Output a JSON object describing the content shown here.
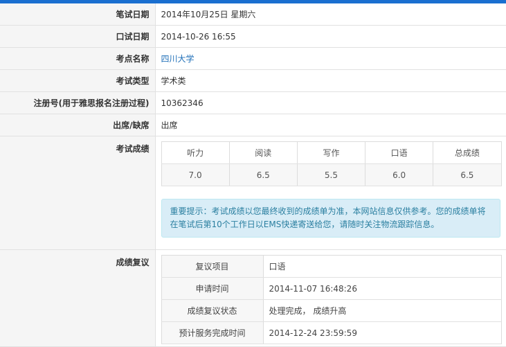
{
  "info": {
    "written_date_label": "笔试日期",
    "written_date": "2014年10月25日 星期六",
    "oral_date_label": "口试日期",
    "oral_date": "2014-10-26 16:55",
    "venue_label": "考点名称",
    "venue": "四川大学",
    "type_label": "考试类型",
    "type": "学术类",
    "reg_label": "注册号(用于雅思报名注册过程)",
    "reg": "10362346",
    "attend_label": "出席/缺席",
    "attend": "出席"
  },
  "scores": {
    "label": "考试成绩",
    "headers": [
      "听力",
      "阅读",
      "写作",
      "口语",
      "总成绩"
    ],
    "values": [
      "7.0",
      "6.5",
      "5.5",
      "6.0",
      "6.5"
    ],
    "notice": "重要提示：考试成绩以您最终收到的成绩单为准，本网站信息仅供参考。您的成绩单将在笔试后第10个工作日以EMS快递寄送给您，请随时关注物流跟踪信息。"
  },
  "recheck": {
    "label": "成绩复议",
    "rows": [
      {
        "k": "复议项目",
        "v": "口语"
      },
      {
        "k": "申请时间",
        "v": "2014-11-07 16:48:26"
      },
      {
        "k": "成绩复议状态",
        "v": "处理完成， 成绩升高"
      },
      {
        "k": "预计服务完成时间",
        "v": "2014-12-24 23:59:59"
      }
    ]
  },
  "colors": {
    "accent": "#1a6fd0",
    "link": "#1f6fb8",
    "notice_bg": "#d9edf7"
  }
}
